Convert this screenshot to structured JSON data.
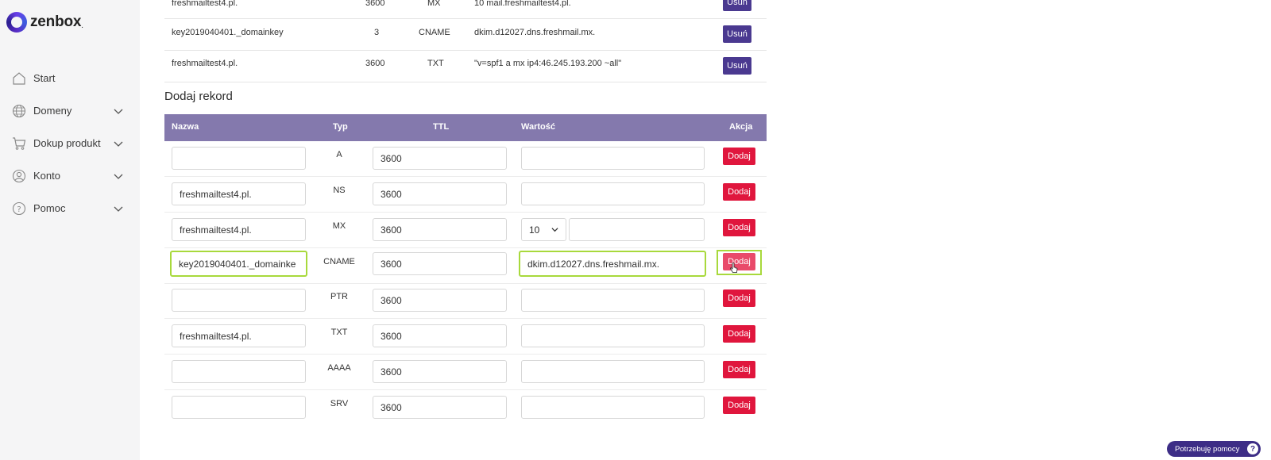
{
  "brand": {
    "name": "zenbox",
    "suffix": "."
  },
  "sidebar": {
    "items": [
      {
        "label": "Start",
        "icon": "home-icon",
        "has_chevron": false
      },
      {
        "label": "Domeny",
        "icon": "globe-icon",
        "has_chevron": true
      },
      {
        "label": "Dokup produkt",
        "icon": "cart-icon",
        "has_chevron": true
      },
      {
        "label": "Konto",
        "icon": "user-icon",
        "has_chevron": true
      },
      {
        "label": "Pomoc",
        "icon": "question-icon",
        "has_chevron": true
      }
    ]
  },
  "existing_records": [
    {
      "name": "freshmailtest4.pl.",
      "ttl": "3600",
      "type": "MX",
      "value": "10 mail.freshmailtest4.pl.",
      "action": "Usuń"
    },
    {
      "name": "key2019040401._domainkey",
      "ttl": "3",
      "type": "CNAME",
      "value": "dkim.d12027.dns.freshmail.mx.",
      "action": "Usuń"
    },
    {
      "name": "freshmailtest4.pl.",
      "ttl": "3600",
      "type": "TXT",
      "value": "\"v=spf1 a mx ip4:46.245.193.200 ~all\"",
      "action": "Usuń"
    }
  ],
  "add_section": {
    "title": "Dodaj rekord",
    "headers": {
      "name": "Nazwa",
      "type": "Typ",
      "ttl": "TTL",
      "value": "Wartość",
      "action": "Akcja"
    },
    "button_label": "Dodaj",
    "rows": [
      {
        "type": "A",
        "name": "",
        "ttl": "3600",
        "value": ""
      },
      {
        "type": "NS",
        "name": "freshmailtest4.pl.",
        "ttl": "3600",
        "value": ""
      },
      {
        "type": "MX",
        "name": "freshmailtest4.pl.",
        "ttl": "3600",
        "priority": "10",
        "value": ""
      },
      {
        "type": "CNAME",
        "name": "key2019040401._domainke",
        "ttl": "3600",
        "value": "dkim.d12027.dns.freshmail.mx."
      },
      {
        "type": "PTR",
        "name": "",
        "ttl": "3600",
        "value": ""
      },
      {
        "type": "TXT",
        "name": "freshmailtest4.pl.",
        "ttl": "3600",
        "value": ""
      },
      {
        "type": "AAAA",
        "name": "",
        "ttl": "3600",
        "value": ""
      },
      {
        "type": "SRV",
        "name": "",
        "ttl": "3600",
        "value": ""
      }
    ]
  },
  "help_widget": {
    "label": "Potrzebuję pomocy",
    "icon": "question-icon"
  },
  "colors": {
    "primary": "#4a3990",
    "header": "#8479ad",
    "danger": "#e0163d",
    "highlight": "#a8d93c"
  }
}
